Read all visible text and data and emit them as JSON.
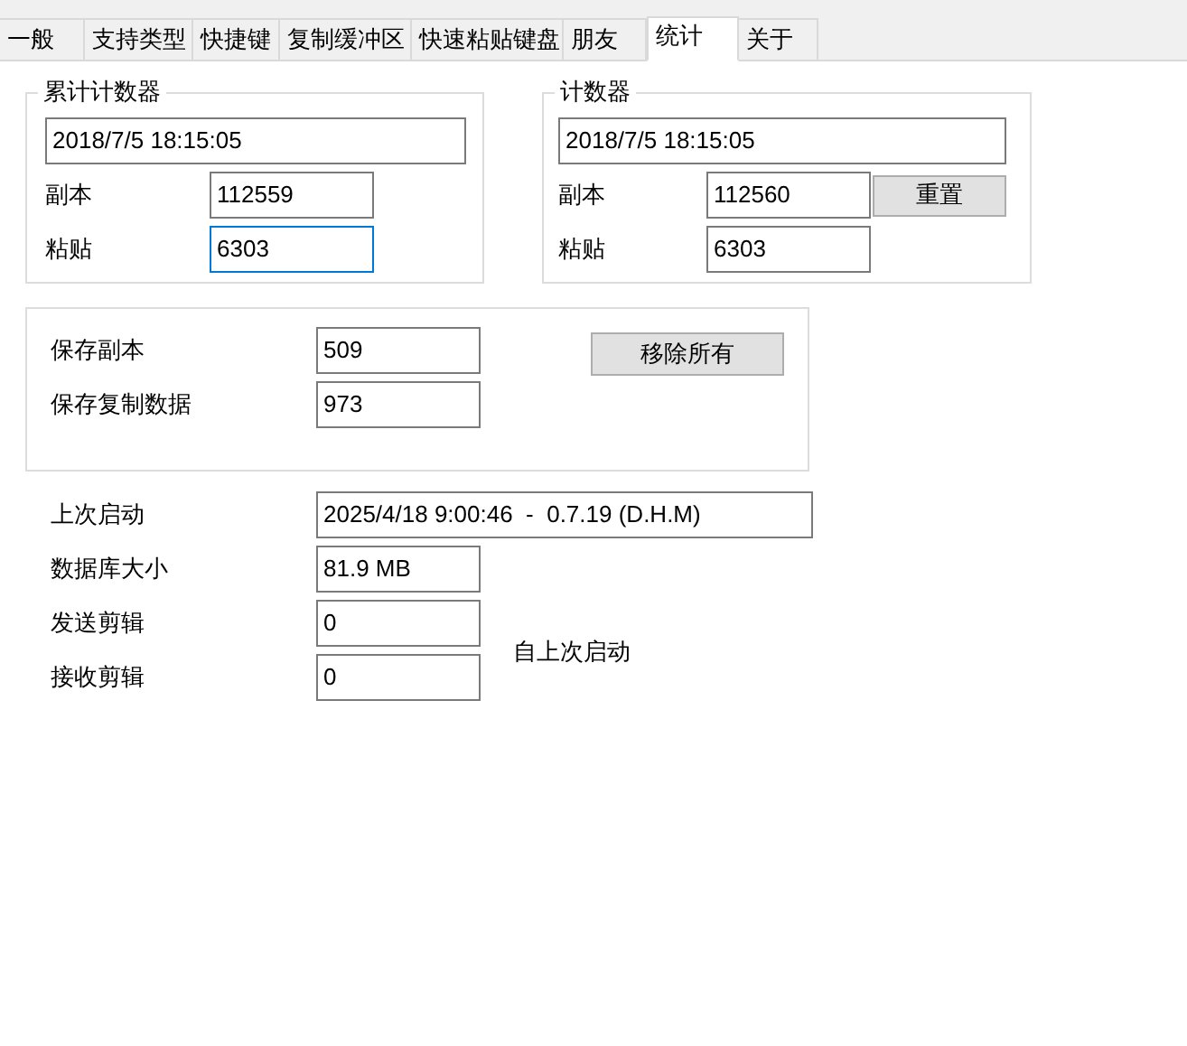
{
  "tabs": [
    {
      "label": "一般",
      "selected": false
    },
    {
      "label": "支持类型",
      "selected": false
    },
    {
      "label": "快捷键",
      "selected": false
    },
    {
      "label": "复制缓冲区",
      "selected": false
    },
    {
      "label": "快速粘贴键盘",
      "selected": false
    },
    {
      "label": "朋友",
      "selected": false
    },
    {
      "label": "统计",
      "selected": true
    },
    {
      "label": "关于",
      "selected": false
    }
  ],
  "total_counter": {
    "title": "累计计数器",
    "date": "2018/7/5 18:15:05",
    "fields": [
      {
        "label": "副本",
        "value": "112559",
        "focused": false
      },
      {
        "label": "粘贴",
        "value": "6303",
        "focused": true
      }
    ]
  },
  "counter": {
    "title": "计数器",
    "date": "2018/7/5 18:15:05",
    "fields": [
      {
        "label": "副本",
        "value": "112560",
        "focused": false
      },
      {
        "label": "粘贴",
        "value": "6303",
        "focused": false
      }
    ],
    "reset_button": "重置"
  },
  "saved": {
    "fields": [
      {
        "label": "保存副本",
        "value": "509"
      },
      {
        "label": "保存复制数据",
        "value": "973"
      }
    ],
    "remove_button": "移除所有"
  },
  "stats": {
    "last_start_label": "上次启动",
    "last_start": "2025/4/18 9:00:46  -  0.7.19 (D.H.M)",
    "fields": [
      {
        "label": "数据库大小",
        "value": "81.9 MB"
      },
      {
        "label": "发送剪辑",
        "value": "0"
      },
      {
        "label": "接收剪辑",
        "value": "0"
      }
    ],
    "since_note": "自上次启动"
  }
}
